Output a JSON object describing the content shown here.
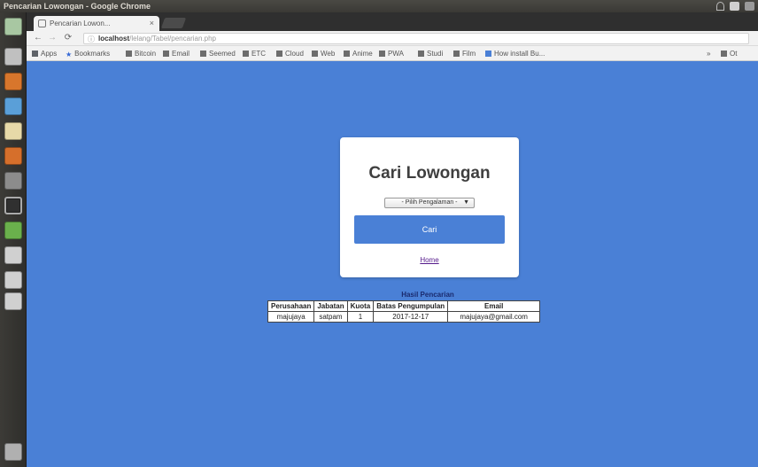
{
  "window": {
    "title": "Pencarian Lowongan - Google Chrome"
  },
  "browser": {
    "tab_title": "Pencarian Lowon...",
    "tab_close": "×",
    "address_host": "localhost",
    "address_path": "/lelang/Tabel/pencarian.php",
    "bookmarks": [
      {
        "label": "Apps",
        "icon": "apps-icon",
        "color": "#5f6368"
      },
      {
        "label": "Bookmarks",
        "icon": "star-icon",
        "color": "#3367d6"
      },
      {
        "label": "Bitcoin",
        "icon": "folder-icon",
        "color": "#6d6d6d"
      },
      {
        "label": "Email",
        "icon": "folder-icon",
        "color": "#6d6d6d"
      },
      {
        "label": "Seemed",
        "icon": "folder-icon",
        "color": "#6d6d6d"
      },
      {
        "label": "ETC",
        "icon": "folder-icon",
        "color": "#6d6d6d"
      },
      {
        "label": "Cloud",
        "icon": "folder-icon",
        "color": "#6d6d6d"
      },
      {
        "label": "Web",
        "icon": "folder-icon",
        "color": "#6d6d6d"
      },
      {
        "label": "Anime",
        "icon": "folder-icon",
        "color": "#6d6d6d"
      },
      {
        "label": "PWA",
        "icon": "folder-icon",
        "color": "#6d6d6d"
      },
      {
        "label": "Studi",
        "icon": "folder-icon",
        "color": "#6d6d6d"
      },
      {
        "label": "Film",
        "icon": "folder-icon",
        "color": "#6d6d6d"
      },
      {
        "label": "How install Bu...",
        "icon": "page-icon",
        "color": "#4a80d6"
      }
    ],
    "bookmarks_overflow": "»",
    "bookmarks_other": "Ot"
  },
  "page": {
    "card_title": "Cari Lowongan",
    "select_value": "- Pilih Pengalaman -",
    "search_button": "Cari",
    "home_link": "Home",
    "result_title": "Hasil Pencarian",
    "table": {
      "headers": [
        "Perusahaan",
        "Jabatan",
        "Kuota",
        "Batas Pengumpulan",
        "Email"
      ],
      "rows": [
        [
          "majujaya",
          "satpam",
          "1",
          "2017-12-17",
          "majujaya@gmail.com"
        ]
      ]
    }
  },
  "colors": {
    "page_background": "#4a80d6",
    "button": "#4a80d6"
  }
}
